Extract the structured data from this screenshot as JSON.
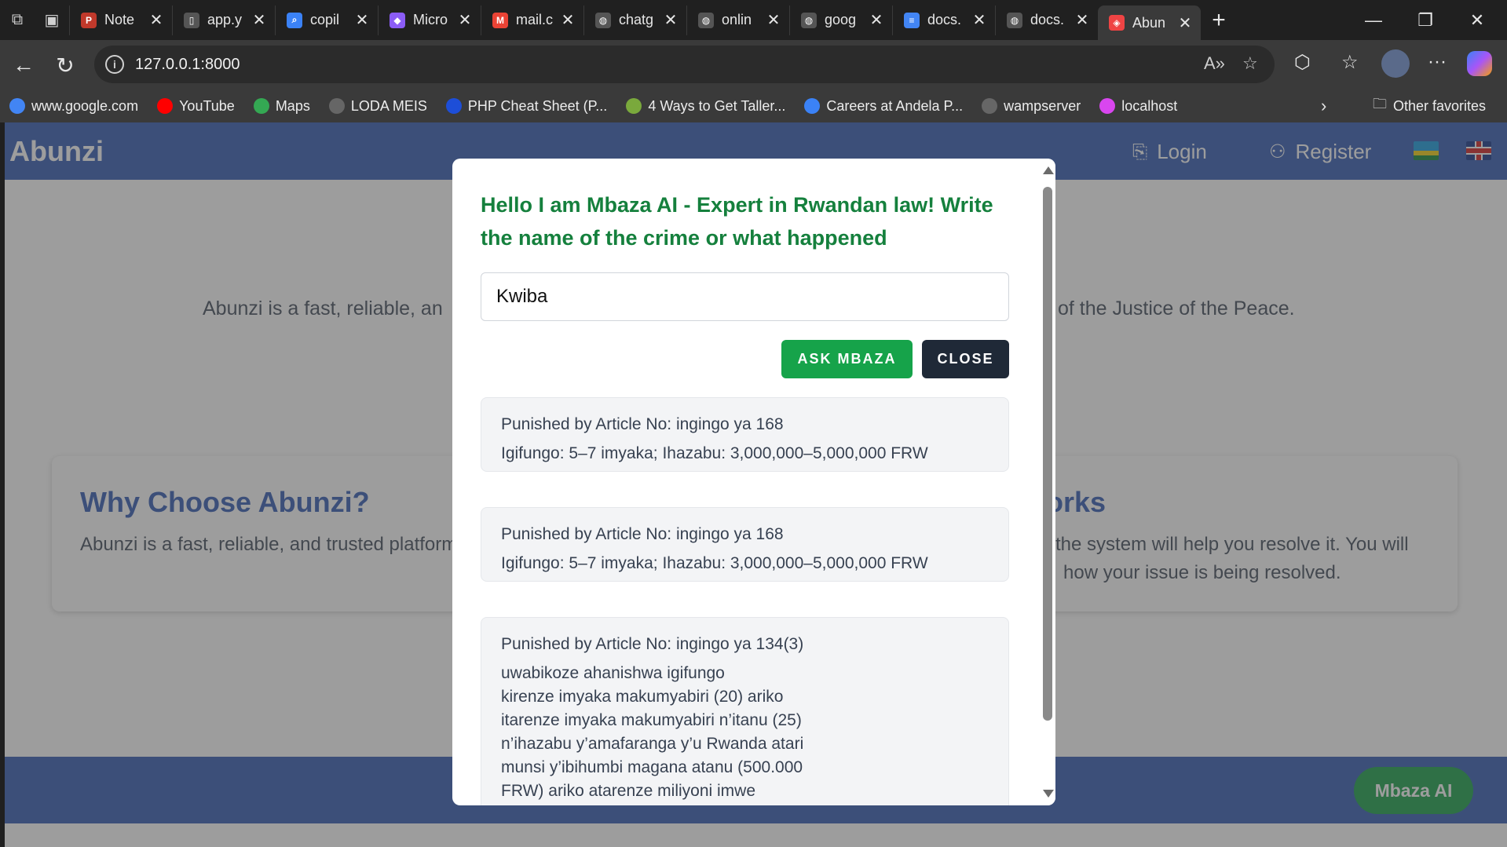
{
  "tabs": [
    {
      "title": "Note",
      "favicon": "pdf-icon",
      "color": "#c0392b"
    },
    {
      "title": "app.y",
      "favicon": "file-icon",
      "color": "#555555"
    },
    {
      "title": "copil",
      "favicon": "search-icon",
      "color": "#3b82f6"
    },
    {
      "title": "Micro",
      "favicon": "copilot-icon",
      "color": "#8b5cf6"
    },
    {
      "title": "mail.c",
      "favicon": "gmail-icon",
      "color": "#ea4335"
    },
    {
      "title": "chatg",
      "favicon": "globe-icon",
      "color": "#555555"
    },
    {
      "title": "onlin",
      "favicon": "globe-icon",
      "color": "#555555"
    },
    {
      "title": "goog",
      "favicon": "globe-icon",
      "color": "#555555"
    },
    {
      "title": "docs.",
      "favicon": "docs-icon",
      "color": "#4285f4"
    },
    {
      "title": "docs.",
      "favicon": "globe-icon",
      "color": "#555555"
    },
    {
      "title": "Abun",
      "favicon": "laravel-icon",
      "color": "#ef4444"
    }
  ],
  "address": {
    "url": "127.0.0.1:8000"
  },
  "bookmarks": [
    {
      "label": "www.google.com",
      "icon": "google-icon",
      "color": "#4285f4"
    },
    {
      "label": "YouTube",
      "icon": "youtube-icon",
      "color": "#ff0000"
    },
    {
      "label": "Maps",
      "icon": "maps-icon",
      "color": "#34a853"
    },
    {
      "label": "LODA MEIS",
      "icon": "globe-icon",
      "color": "#666666"
    },
    {
      "label": "PHP Cheat Sheet (P...",
      "icon": "php-icon",
      "color": "#1d4ed8"
    },
    {
      "label": "4 Ways to Get Taller...",
      "icon": "wikihow-icon",
      "color": "#7aa93c"
    },
    {
      "label": "Careers at Andela  P...",
      "icon": "andela-icon",
      "color": "#3b82f6"
    },
    {
      "label": "wampserver",
      "icon": "wamp-icon",
      "color": "#666666"
    },
    {
      "label": "localhost",
      "icon": "localhost-icon",
      "color": "#d946ef"
    }
  ],
  "bookmarks_other": "Other favorites",
  "site": {
    "brand": "Abunzi",
    "login": "Login",
    "register": "Register",
    "hero_left": "Abunzi is a fast, reliable, an",
    "hero_right": "of the Justice of the Peace.",
    "why_title": "Why Choose Abunzi?",
    "why_text": "Abunzi is a fast, reliable, and trusted platform",
    "how_title_partial": "orks",
    "how_line1": "d the system will help you resolve it. You will",
    "how_line2": "how your issue is being resolved.",
    "mbaza_button": "Mbaza AI",
    "colors": {
      "primary": "#3c63b7",
      "green": "#16a34a",
      "dark": "#1f2937"
    }
  },
  "modal": {
    "title": "Hello I am Mbaza AI - Expert in Rwandan law! Write the name of the crime or what happened",
    "input_value": "Kwiba",
    "ask_label": "ASK MBAZA",
    "close_label": "CLOSE",
    "results": [
      {
        "heading": "Punished by Article No: ingingo ya 168",
        "body": "Igifungo: 5–7 imyaka; Ihazabu: 3,000,000–5,000,000 FRW"
      },
      {
        "heading": "Punished by Article No: ingingo ya 168",
        "body": "Igifungo: 5–7 imyaka; Ihazabu: 3,000,000–5,000,000 FRW"
      },
      {
        "heading": "Punished by Article No: ingingo ya 134(3)",
        "body": "uwabikoze ahanishwa igifungo\nkirenze imyaka makumyabiri (20) ariko\nitarenze imyaka makumyabiri n’itanu (25)\nn’ihazabu y’amafaranga y’u Rwanda atari\nmunsi y’ibihumbi magana atanu (500.000\nFRW) ariko atarenze miliyoni imwe"
      }
    ]
  }
}
